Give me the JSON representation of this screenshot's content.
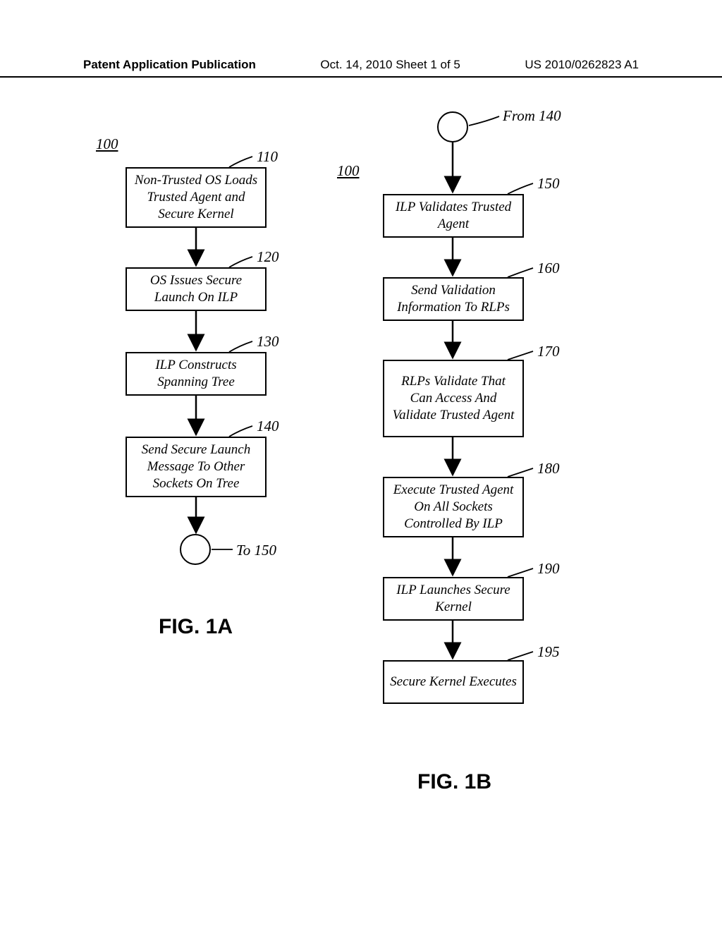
{
  "header": {
    "left": "Patent Application Publication",
    "mid": "Oct. 14, 2010  Sheet 1 of 5",
    "right": "US 2010/0262823 A1"
  },
  "figA": {
    "ref100": "100",
    "steps": {
      "s110": {
        "num": "110",
        "text": "Non-Trusted OS Loads Trusted Agent and Secure Kernel"
      },
      "s120": {
        "num": "120",
        "text": "OS Issues Secure Launch On ILP"
      },
      "s130": {
        "num": "130",
        "text": "ILP Constructs Spanning Tree"
      },
      "s140": {
        "num": "140",
        "text": "Send Secure Launch Message To Other Sockets On Tree"
      }
    },
    "connector_to": "To 150",
    "caption": "FIG. 1A"
  },
  "figB": {
    "ref100": "100",
    "connector_from": "From 140",
    "steps": {
      "s150": {
        "num": "150",
        "text": "ILP Validates Trusted Agent"
      },
      "s160": {
        "num": "160",
        "text": "Send Validation Information To RLPs"
      },
      "s170": {
        "num": "170",
        "text": "RLPs Validate That Can Access And Validate Trusted Agent"
      },
      "s180": {
        "num": "180",
        "text": "Execute Trusted Agent On All Sockets Controlled By ILP"
      },
      "s190": {
        "num": "190",
        "text": "ILP Launches Secure Kernel"
      },
      "s195": {
        "num": "195",
        "text": "Secure Kernel Executes"
      }
    },
    "caption": "FIG. 1B"
  }
}
